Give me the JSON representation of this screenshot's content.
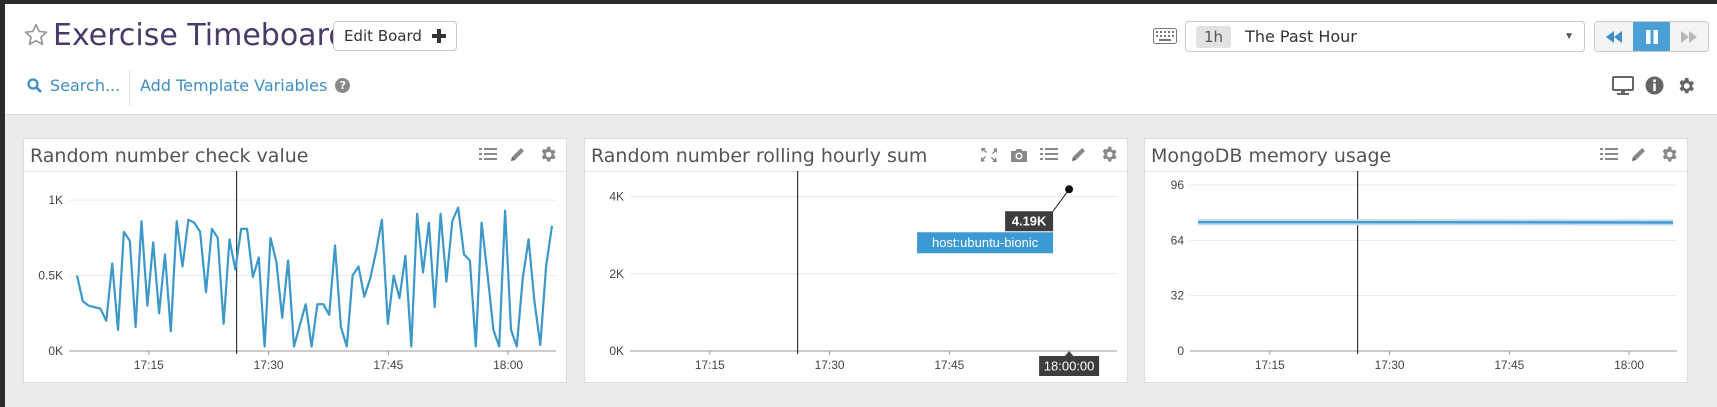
{
  "header": {
    "title": "Exercise Timeboard",
    "edit_label": "Edit Board",
    "timeframe_badge": "1h",
    "timeframe_label": "The Past Hour",
    "search_label": "Search...",
    "template_label": "Add Template Variables",
    "help_glyph": "?"
  },
  "colors": {
    "accent": "#3e8ec4",
    "series": "#3b98c9",
    "dark_label": "#3d3d3d",
    "tag": "#3b9ad4"
  },
  "panels": [
    {
      "title": "Random number check value",
      "tools": [
        "list-icon",
        "pencil-icon",
        "gear-icon"
      ],
      "chart_data": {
        "type": "line",
        "x_ticks": [
          "17:15",
          "17:30",
          "17:45",
          "18:00"
        ],
        "y_ticks": [
          "0K",
          "0.5K",
          "1K"
        ],
        "ylim": [
          0,
          1100
        ],
        "x_range": [
          "17:05",
          "18:06"
        ],
        "cursor_x": "17:26",
        "series": [
          {
            "values": [
              500,
              330,
              300,
              290,
              280,
              200,
              580,
              140,
              790,
              730,
              160,
              860,
              300,
              720,
              250,
              640,
              130,
              860,
              560,
              870,
              850,
              790,
              390,
              810,
              750,
              180,
              740,
              540,
              810,
              810,
              490,
              620,
              30,
              750,
              590,
              220,
              600,
              30,
              170,
              310,
              30,
              310,
              310,
              240,
              700,
              160,
              30,
              500,
              560,
              360,
              480,
              660,
              870,
              180,
              500,
              350,
              630,
              30,
              910,
              520,
              850,
              290,
              910,
              460,
              860,
              950,
              640,
              600,
              30,
              850,
              510,
              140,
              30,
              930,
              140,
              30,
              480,
              740,
              330,
              40,
              560,
              830
            ]
          }
        ]
      }
    },
    {
      "title": "Random number rolling hourly sum",
      "tools": [
        "expand-icon",
        "camera-icon",
        "list-icon",
        "pencil-icon",
        "gear-icon"
      ],
      "chart_data": {
        "type": "scatter",
        "x_ticks": [
          "17:15",
          "17:30",
          "17:45",
          "18:00"
        ],
        "y_ticks": [
          "0K",
          "2K",
          "4K"
        ],
        "ylim": [
          0,
          4300
        ],
        "x_range": [
          "17:05",
          "18:06"
        ],
        "cursor_x": "17:26",
        "point": {
          "x": "18:00",
          "y": 4190
        },
        "value_label": "4.19K",
        "tag_label": "host:ubuntu-bionic",
        "x_flag": "18:00:00"
      }
    },
    {
      "title": "MongoDB memory usage",
      "tools": [
        "list-icon",
        "pencil-icon",
        "gear-icon"
      ],
      "chart_data": {
        "type": "line",
        "x_ticks": [
          "17:15",
          "17:30",
          "17:45",
          "18:00"
        ],
        "y_ticks": [
          "0",
          "32",
          "64",
          "96"
        ],
        "ylim": [
          0,
          96
        ],
        "x_range": [
          "17:05",
          "18:06"
        ],
        "cursor_x": "17:26",
        "series": [
          {
            "values": [
              74.5,
              74.5,
              74.4,
              74.3
            ]
          }
        ]
      }
    }
  ]
}
